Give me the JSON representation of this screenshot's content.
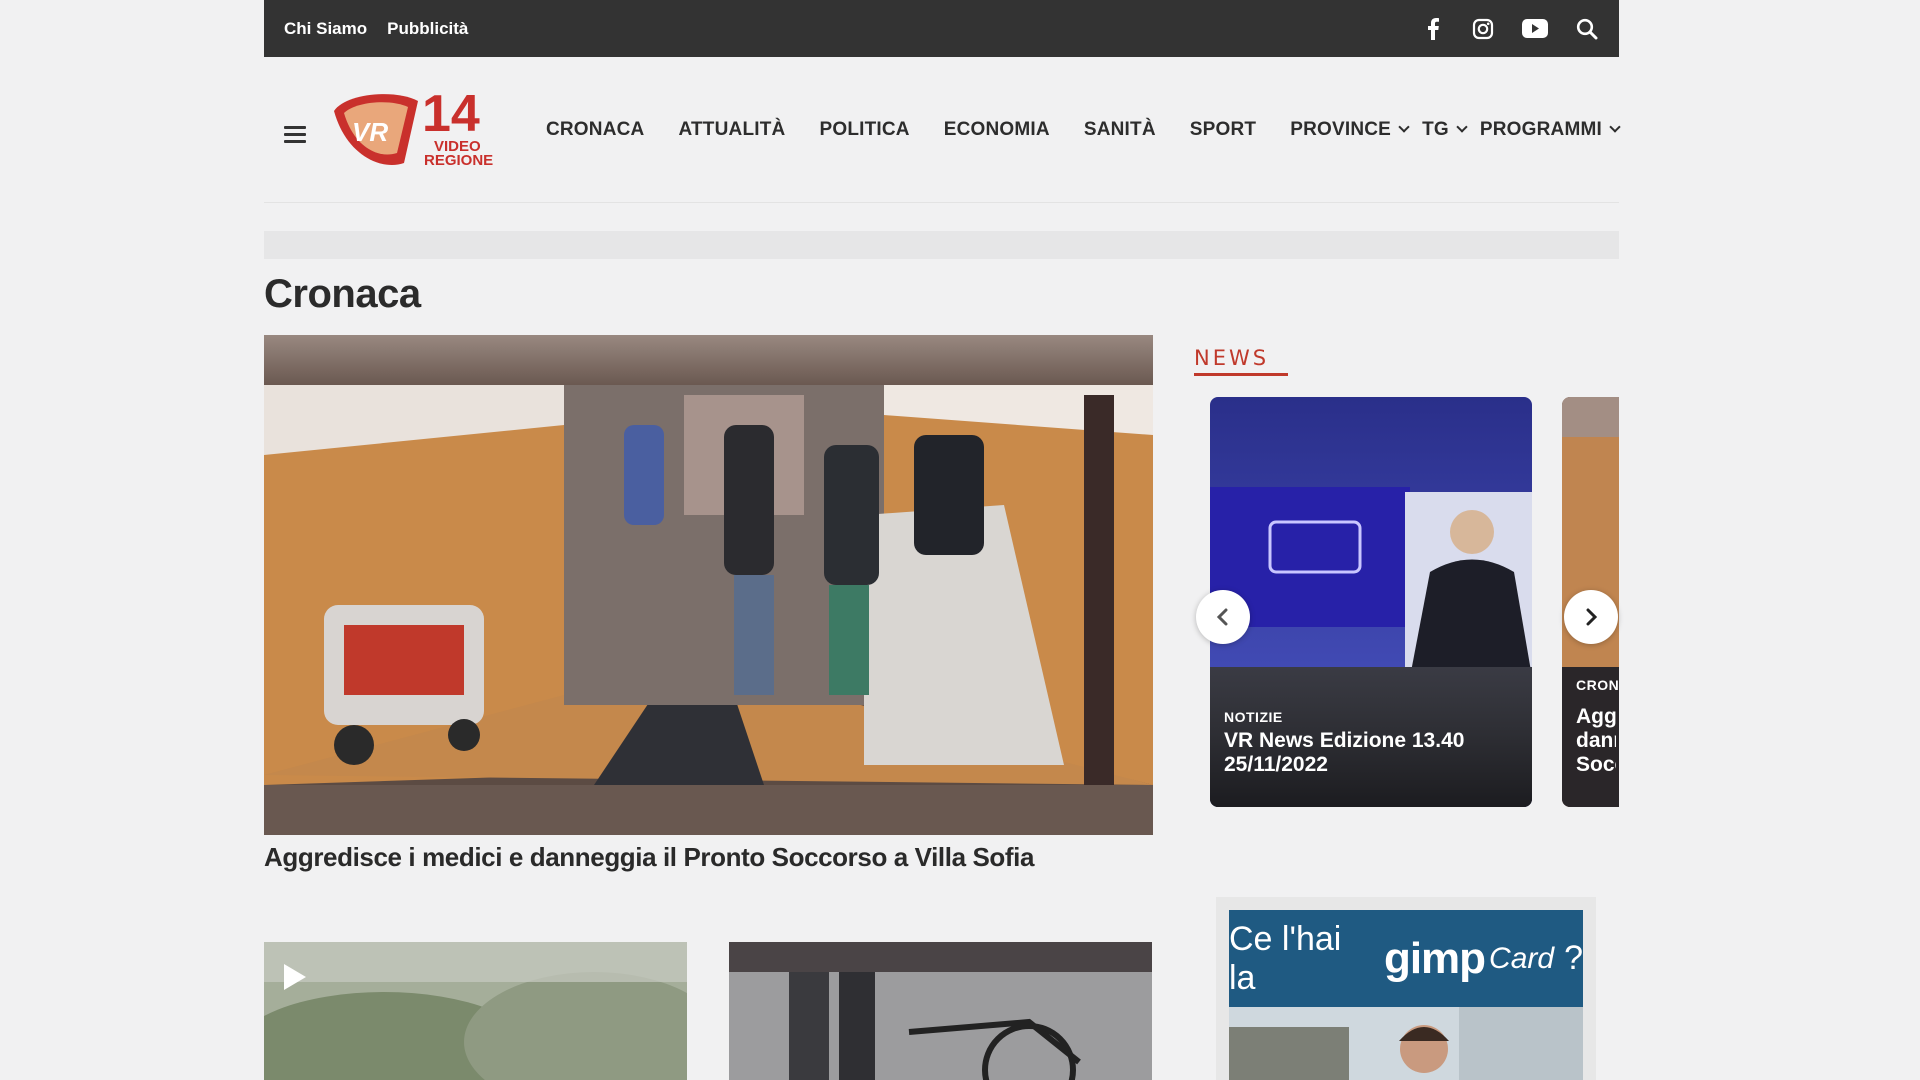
{
  "topbar": {
    "links": [
      "Chi Siamo",
      "Pubblicità"
    ],
    "icons": [
      "facebook-icon",
      "instagram-icon",
      "youtube-icon",
      "search-icon"
    ]
  },
  "logo": {
    "number": "14",
    "badge": "VR",
    "line1": "VIDEO",
    "line2": "REGIONE"
  },
  "nav": {
    "items": [
      {
        "label": "CRONACA"
      },
      {
        "label": "ATTUALITÀ"
      },
      {
        "label": "POLITICA"
      },
      {
        "label": "ECONOMIA"
      },
      {
        "label": "SANITÀ"
      },
      {
        "label": "SPORT"
      },
      {
        "label": "PROVINCE",
        "dropdown": true
      },
      {
        "label": "TG",
        "dropdown": true
      },
      {
        "label": "PROGRAMMI",
        "dropdown": true
      }
    ]
  },
  "page": {
    "title": "Cronaca",
    "hero_title": "Aggredisce i medici e danneggia il Pronto Soccorso a Villa Sofia"
  },
  "news": {
    "label": "NEWS",
    "cards": [
      {
        "category": "NOTIZIE",
        "title": "VR News Edizione 13.40 25/11/2022"
      },
      {
        "category": "CRON",
        "title": "Agg dann Socc"
      }
    ]
  },
  "ad": {
    "pre": "Ce l'hai la",
    "brand": "gimp",
    "card": "Card",
    "post": "?"
  },
  "colors": {
    "accent": "#c0392b",
    "topbar": "#333333",
    "background": "#f1f1f2"
  }
}
